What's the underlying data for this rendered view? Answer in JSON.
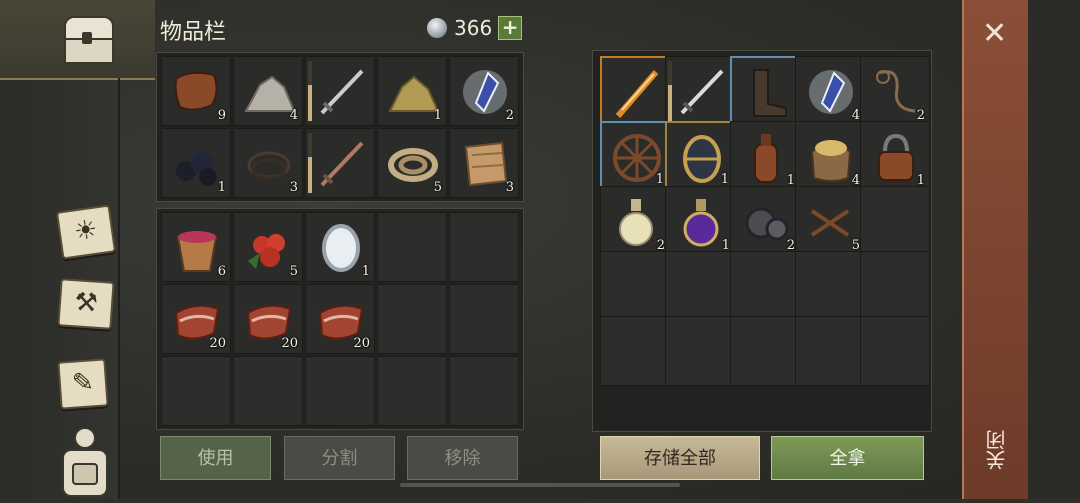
{
  "inventory": {
    "title": "物品栏",
    "currency": "366",
    "plus_label": "+"
  },
  "left_grid_top": [
    {
      "name": "leather-hide",
      "count": "9"
    },
    {
      "name": "stone-pile",
      "count": "4"
    },
    {
      "name": "iron-sword",
      "count": ""
    },
    {
      "name": "sulfur-pile",
      "count": "1"
    },
    {
      "name": "crystal-shard",
      "count": "2"
    },
    {
      "name": "coal-lumps",
      "count": "1"
    },
    {
      "name": "wire-coil",
      "count": "3"
    },
    {
      "name": "copper-sword",
      "count": ""
    },
    {
      "name": "rope-coil",
      "count": "5"
    },
    {
      "name": "cloth-roll",
      "count": "3"
    }
  ],
  "left_grid_food": [
    {
      "name": "berry-bucket",
      "count": "6"
    },
    {
      "name": "red-berries",
      "count": "5"
    },
    {
      "name": "silver-mirror",
      "count": "1"
    },
    {
      "name": "raw-meat",
      "count": "20"
    },
    {
      "name": "raw-meat",
      "count": "20"
    },
    {
      "name": "raw-meat",
      "count": "20"
    }
  ],
  "storage_grid": [
    {
      "name": "fire-staff",
      "count": ""
    },
    {
      "name": "steel-sword",
      "count": ""
    },
    {
      "name": "leather-boots",
      "count": ""
    },
    {
      "name": "crystal-shard",
      "count": "4"
    },
    {
      "name": "whip-rope",
      "count": "2"
    },
    {
      "name": "cart-wheel",
      "count": "1"
    },
    {
      "name": "golden-egg",
      "count": "1"
    },
    {
      "name": "leather-flask",
      "count": "1"
    },
    {
      "name": "grain-sack",
      "count": "4"
    },
    {
      "name": "padlock",
      "count": "1"
    },
    {
      "name": "potion-flask",
      "count": "2"
    },
    {
      "name": "magic-potion",
      "count": "1"
    },
    {
      "name": "gear-parts",
      "count": "2"
    },
    {
      "name": "nails",
      "count": "5"
    }
  ],
  "buttons": {
    "use": "使用",
    "split": "分割",
    "remove": "移除",
    "store_all": "存储全部",
    "take_all": "全拿"
  },
  "close": {
    "label": "关闭",
    "x": "✕"
  },
  "colors": {
    "accent_green": "#5f7a42",
    "close_bar": "#7a442e",
    "rarity_orange": "#c47a2a",
    "rarity_blue": "#5e8fb0"
  }
}
